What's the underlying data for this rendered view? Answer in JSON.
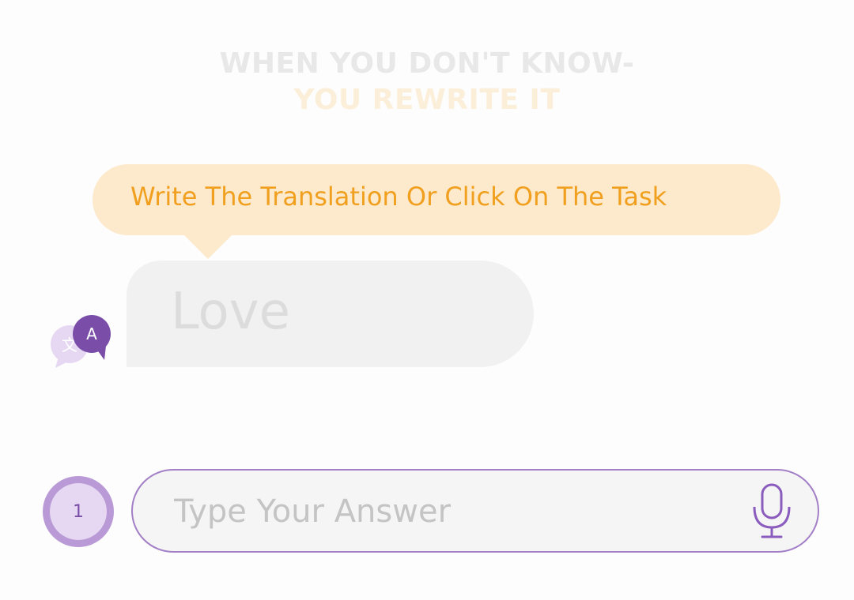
{
  "headline": {
    "line1": "WHEN YOU DON'T KNOW-",
    "line2": "YOU REWRITE IT"
  },
  "tooltip": {
    "text": "Write The Translation Or Click On The Task"
  },
  "task": {
    "word": "Love"
  },
  "translate_badge": {
    "letter": "A",
    "glyph": "文",
    "icon": "translate-icon"
  },
  "step": {
    "number": "1"
  },
  "answer": {
    "placeholder": "Type Your Answer",
    "value": ""
  },
  "icons": {
    "mic": "microphone-icon"
  },
  "colors": {
    "accent_purple": "#7a4ea8",
    "tooltip_bg": "#fde9cb",
    "tooltip_text": "#f0a01e",
    "field_border": "#a27fc6"
  }
}
